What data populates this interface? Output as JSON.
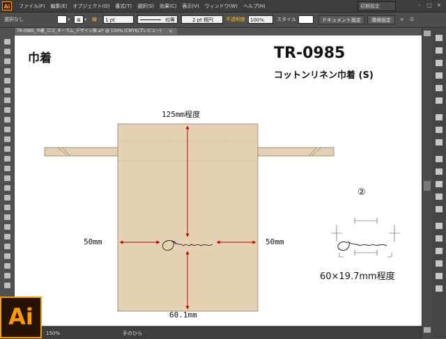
{
  "app": {
    "logo": "Ai",
    "menus": [
      "ファイル(F)",
      "編集(E)",
      "オブジェクト(O)",
      "書式(T)",
      "選択(S)",
      "効果(C)",
      "表示(V)",
      "ウィンドウ(W)",
      "ヘルプ(H)"
    ],
    "workspace": "初期設定"
  },
  "control_bar": {
    "selection": "選択なし",
    "stroke_label": "線 :",
    "stroke_weight": "1 pt",
    "uniform": "均等",
    "brush": "2 pt 楕円",
    "opacity_label": "不透明度 :",
    "opacity": "100%",
    "style_label": "スタイル :",
    "doc_setup": "ドキュメント設定",
    "preferences": "環境設定"
  },
  "tab": {
    "title": "TR-0985_巾着_ロゴ_オーラム_デザイン案.ai* @ 150% (CMYK/プレビュー)",
    "close": "×"
  },
  "artboard": {
    "title": "巾着",
    "product_code": "TR-0985",
    "product_name": "コットンリネン巾着 (S)",
    "dim_top": "125mm程度",
    "dim_left": "50mm",
    "dim_right": "50mm",
    "dim_bottom": "60.1mm",
    "circle_number": "②",
    "logo_size": "60×19.7mm程度"
  },
  "colors": {
    "bag_fill": "#e5d2b5",
    "bag_stroke": "#8a7a63",
    "dimension_arrow": "#cc0000"
  },
  "status": {
    "zoom": "150%",
    "tool": "手のひら"
  }
}
